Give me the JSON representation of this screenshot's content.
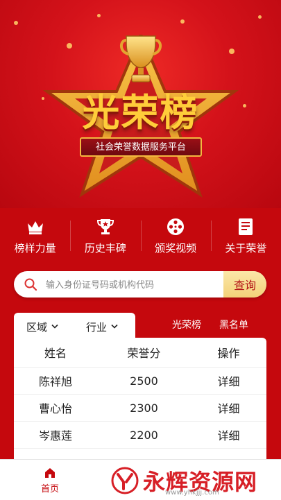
{
  "hero": {
    "title": "光荣榜",
    "subtitle": "社会荣誉数据服务平台"
  },
  "nav": {
    "items": [
      {
        "label": "榜样力量",
        "icon": "crown-icon"
      },
      {
        "label": "历史丰碑",
        "icon": "trophy-icon"
      },
      {
        "label": "颁奖视频",
        "icon": "film-reel-icon"
      },
      {
        "label": "关于荣誉",
        "icon": "document-icon"
      }
    ]
  },
  "search": {
    "placeholder": "输入身份证号码或机构代码",
    "button_label": "查询"
  },
  "filters": {
    "region": "区域",
    "industry": "行业"
  },
  "tabs": [
    "光荣榜",
    "黑名单"
  ],
  "table": {
    "headers": [
      "姓名",
      "荣誉分",
      "操作"
    ],
    "rows": [
      {
        "name": "陈祥旭",
        "score": "2500",
        "action": "详细"
      },
      {
        "name": "曹心怡",
        "score": "2300",
        "action": "详细"
      },
      {
        "name": "岑惠莲",
        "score": "2200",
        "action": "详细"
      }
    ]
  },
  "bottom_nav": {
    "home_label": "首页"
  },
  "watermark": {
    "text": "永辉资源网",
    "url": "www.yhkjjj.com"
  },
  "colors": {
    "brand_red": "#c5080d",
    "gold": "#ffcd3a",
    "search_button": "#f3d179"
  }
}
